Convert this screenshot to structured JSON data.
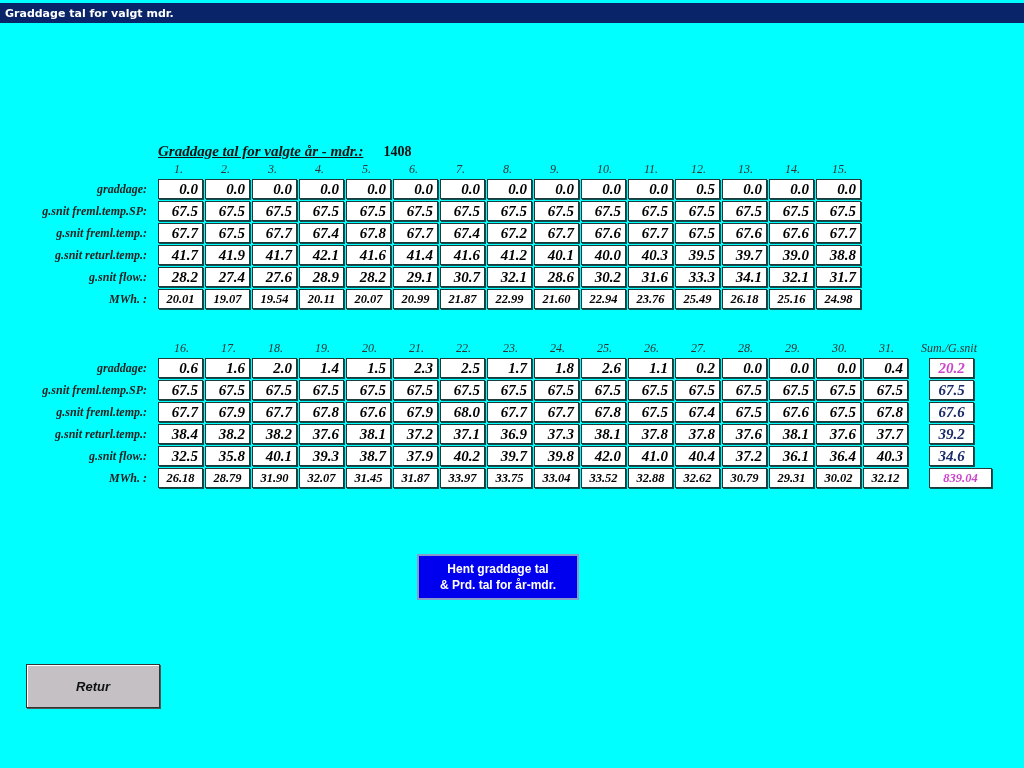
{
  "window": {
    "title": "Graddage tal for valgt mdr."
  },
  "heading": {
    "label": "Graddage tal for valgte år - mdr.:",
    "value": "1408"
  },
  "blocks": [
    {
      "columns": [
        "1.",
        "2.",
        "3.",
        "4.",
        "5.",
        "6.",
        "7.",
        "8.",
        "9.",
        "10.",
        "11.",
        "12.",
        "13.",
        "14.",
        "15."
      ],
      "rows": [
        {
          "kind": "normal",
          "label": "graddage:",
          "values": [
            "0.0",
            "0.0",
            "0.0",
            "0.0",
            "0.0",
            "0.0",
            "0.0",
            "0.0",
            "0.0",
            "0.0",
            "0.0",
            "0.5",
            "0.0",
            "0.0",
            "0.0"
          ]
        },
        {
          "kind": "normal",
          "label": "g.snit freml.temp.SP:",
          "values": [
            "67.5",
            "67.5",
            "67.5",
            "67.5",
            "67.5",
            "67.5",
            "67.5",
            "67.5",
            "67.5",
            "67.5",
            "67.5",
            "67.5",
            "67.5",
            "67.5",
            "67.5"
          ]
        },
        {
          "kind": "normal",
          "label": "g.snit freml.temp.:",
          "values": [
            "67.7",
            "67.5",
            "67.7",
            "67.4",
            "67.8",
            "67.7",
            "67.4",
            "67.2",
            "67.7",
            "67.6",
            "67.7",
            "67.5",
            "67.6",
            "67.6",
            "67.7"
          ]
        },
        {
          "kind": "normal",
          "label": "g.snit returl.temp.:",
          "values": [
            "41.7",
            "41.9",
            "41.7",
            "42.1",
            "41.6",
            "41.4",
            "41.6",
            "41.2",
            "40.1",
            "40.0",
            "40.3",
            "39.5",
            "39.7",
            "39.0",
            "38.8"
          ]
        },
        {
          "kind": "normal",
          "label": "g.snit flow.:",
          "values": [
            "28.2",
            "27.4",
            "27.6",
            "28.9",
            "28.2",
            "29.1",
            "30.7",
            "32.1",
            "28.6",
            "30.2",
            "31.6",
            "33.3",
            "34.1",
            "32.1",
            "31.7"
          ]
        },
        {
          "kind": "energy",
          "label": "MWh. :",
          "values": [
            "20.01",
            "19.07",
            "19.54",
            "20.11",
            "20.07",
            "20.99",
            "21.87",
            "22.99",
            "21.60",
            "22.94",
            "23.76",
            "25.49",
            "26.18",
            "25.16",
            "24.98"
          ]
        }
      ]
    },
    {
      "columns": [
        "16.",
        "17.",
        "18.",
        "19.",
        "20.",
        "21.",
        "22.",
        "23.",
        "24.",
        "25.",
        "26.",
        "27.",
        "28.",
        "29.",
        "30.",
        "31."
      ],
      "rows": [
        {
          "kind": "normal",
          "label": "graddage:",
          "values": [
            "0.6",
            "1.6",
            "2.0",
            "1.4",
            "1.5",
            "2.3",
            "2.5",
            "1.7",
            "1.8",
            "2.6",
            "1.1",
            "0.2",
            "0.0",
            "0.0",
            "0.0",
            "0.4"
          ]
        },
        {
          "kind": "normal",
          "label": "g.snit freml.temp.SP:",
          "values": [
            "67.5",
            "67.5",
            "67.5",
            "67.5",
            "67.5",
            "67.5",
            "67.5",
            "67.5",
            "67.5",
            "67.5",
            "67.5",
            "67.5",
            "67.5",
            "67.5",
            "67.5",
            "67.5"
          ]
        },
        {
          "kind": "normal",
          "label": "g.snit freml.temp.:",
          "values": [
            "67.7",
            "67.9",
            "67.7",
            "67.8",
            "67.6",
            "67.9",
            "68.0",
            "67.7",
            "67.7",
            "67.8",
            "67.5",
            "67.4",
            "67.5",
            "67.6",
            "67.5",
            "67.8"
          ]
        },
        {
          "kind": "normal",
          "label": "g.snit returl.temp.:",
          "values": [
            "38.4",
            "38.2",
            "38.2",
            "37.6",
            "38.1",
            "37.2",
            "37.1",
            "36.9",
            "37.3",
            "38.1",
            "37.8",
            "37.8",
            "37.6",
            "38.1",
            "37.6",
            "37.7"
          ]
        },
        {
          "kind": "normal",
          "label": "g.snit flow.:",
          "values": [
            "32.5",
            "35.8",
            "40.1",
            "39.3",
            "38.7",
            "37.9",
            "40.2",
            "39.7",
            "39.8",
            "42.0",
            "41.0",
            "40.4",
            "37.2",
            "36.1",
            "36.4",
            "40.3"
          ]
        },
        {
          "kind": "energy",
          "label": "MWh. :",
          "values": [
            "26.18",
            "28.79",
            "31.90",
            "32.07",
            "31.45",
            "31.87",
            "33.97",
            "33.75",
            "33.04",
            "33.52",
            "32.88",
            "32.62",
            "30.79",
            "29.31",
            "30.02",
            "32.12"
          ]
        }
      ],
      "summary": {
        "heading": "Sum./G.snit",
        "cells": [
          {
            "value": "20.2",
            "color": "#cc44cc"
          },
          {
            "value": "67.5",
            "color": "#1a2a6a"
          },
          {
            "value": "67.6",
            "color": "#1a2a6a"
          },
          {
            "value": "39.2",
            "color": "#1a2a6a"
          },
          {
            "value": "34.6",
            "color": "#1a2a6a"
          },
          {
            "value": "839.04",
            "color": "#cc44cc"
          }
        ]
      }
    }
  ],
  "buttons": {
    "fetch": "Hent graddage tal\n& Prd. tal for år-mdr.",
    "back": "Retur"
  }
}
